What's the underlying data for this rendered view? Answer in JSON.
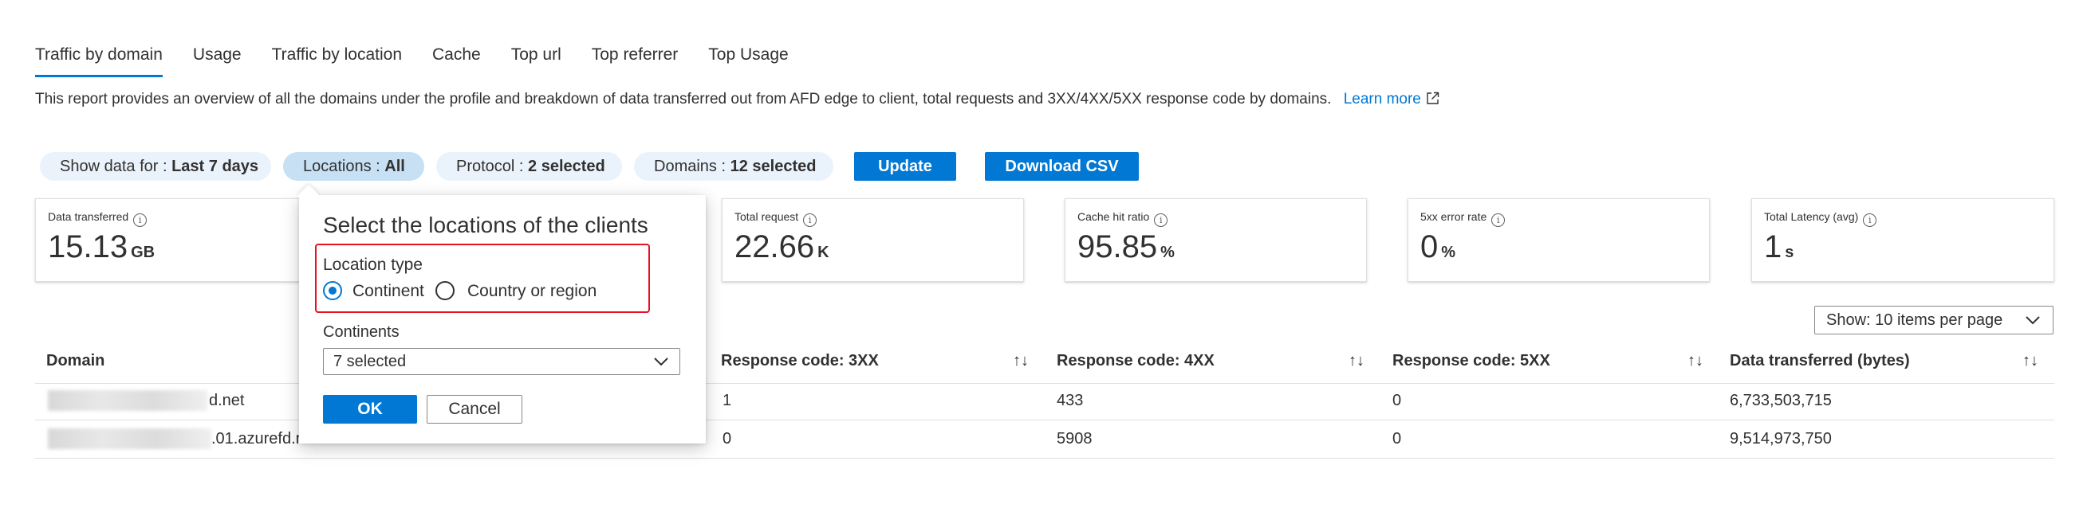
{
  "tabs": [
    {
      "label": "Traffic by domain",
      "active": true
    },
    {
      "label": "Usage"
    },
    {
      "label": "Traffic by location"
    },
    {
      "label": "Cache"
    },
    {
      "label": "Top url"
    },
    {
      "label": "Top referrer"
    },
    {
      "label": "Top Usage"
    }
  ],
  "description": {
    "text": "This report provides an overview of all the domains under the profile and breakdown of data transferred out from AFD edge to client, total requests and 3XX/4XX/5XX response code by domains.",
    "link": "Learn more"
  },
  "filters": {
    "show_data_label": "Show data for : ",
    "show_data_value": "Last 7 days",
    "locations_label": "Locations : ",
    "locations_value": "All",
    "protocol_label": "Protocol : ",
    "protocol_value": "2 selected",
    "domains_label": "Domains : ",
    "domains_value": "12 selected",
    "update_label": "Update",
    "download_label": "Download CSV"
  },
  "metrics": [
    {
      "label": "Data transferred",
      "value": "15.13",
      "unit": "GB"
    },
    {
      "label": "Total request",
      "value": "22.66",
      "unit": "K"
    },
    {
      "label": "Cache hit ratio",
      "value": "95.85",
      "unit": "%"
    },
    {
      "label": "5xx error rate",
      "value": "0",
      "unit": "%"
    },
    {
      "label": "Total Latency (avg)",
      "value": "1",
      "unit": "s"
    }
  ],
  "items_per_page": "Show: 10 items per page",
  "table": {
    "headers": [
      "Domain",
      "Response code: 3XX",
      "Response code: 4XX",
      "Response code: 5XX",
      "Data transferred (bytes)"
    ],
    "sort_glyph": "↑↓",
    "rows": [
      {
        "domain": "d.net",
        "r3xx": "1",
        "r4xx": "433",
        "r5xx": "0",
        "bytes": "6,733,503,715"
      },
      {
        "domain": ".01.azurefd.n",
        "r3xx": "0",
        "r4xx": "5908",
        "r5xx": "0",
        "bytes": "9,514,973,750"
      }
    ]
  },
  "popup": {
    "title": "Select the locations of the clients",
    "location_type_label": "Location type",
    "option_continent": "Continent",
    "option_country": "Country or region",
    "selected_option": "Continent",
    "continents_label": "Continents",
    "continents_value": "7 selected",
    "ok_label": "OK",
    "cancel_label": "Cancel"
  },
  "colors": {
    "accent": "#0078d4",
    "highlight_border": "#e81123",
    "pill_bg": "#eaf3fb",
    "pill_selected_bg": "#c7e0f4"
  }
}
